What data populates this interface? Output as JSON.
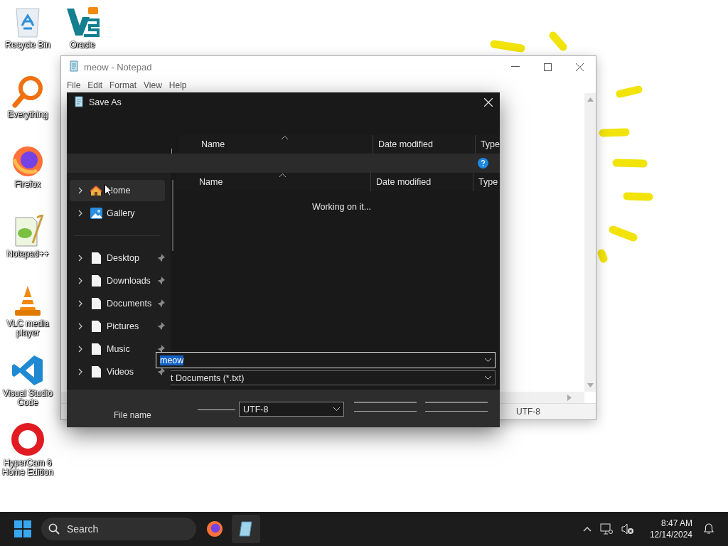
{
  "desktop_icons": [
    {
      "label": "Recycle Bin",
      "kind": "recycle"
    },
    {
      "label": "Oracle",
      "kind": "oracle"
    },
    {
      "label": "Everything",
      "kind": "everything"
    },
    {
      "label": "Firefox",
      "kind": "firefox"
    },
    {
      "label": "Notepad++",
      "kind": "notepadpp"
    },
    {
      "label": "VLC media player",
      "kind": "vlc"
    },
    {
      "label": "Visual Studio Code",
      "kind": "vscode"
    },
    {
      "label": "HyperCam 6 Home Edition",
      "kind": "hypercam"
    }
  ],
  "notepad": {
    "title": "meow - Notepad",
    "menu": [
      "File",
      "Edit",
      "Format",
      "View",
      "Help"
    ],
    "status_encoding": "UTF-8"
  },
  "save_dialog": {
    "title": "Save As",
    "columns": [
      "Name",
      "Date modified",
      "Type"
    ],
    "columns_lower": [
      "Name",
      "Date modified",
      "Type"
    ],
    "message": "Working on it...",
    "nav_top": [
      {
        "label": "Home",
        "kind": "home",
        "selected": true
      },
      {
        "label": "Gallery",
        "kind": "gallery",
        "selected": false
      }
    ],
    "nav_pinned": [
      {
        "label": "Desktop",
        "selected": false
      },
      {
        "label": "Downloads",
        "selected": false
      },
      {
        "label": "Documents",
        "selected": false
      },
      {
        "label": "Pictures",
        "selected": false
      },
      {
        "label": "Music",
        "selected": false
      },
      {
        "label": "Videos",
        "selected": false
      }
    ],
    "file_name_label": "File name",
    "file_name": "meow",
    "file_type": "t Documents (*.txt)",
    "encoding": "UTF-8"
  },
  "taskbar": {
    "search_placeholder": "Search",
    "apps": [
      {
        "kind": "firefox",
        "selected": false
      },
      {
        "kind": "notepad",
        "selected": true
      }
    ],
    "time": "8:47 AM",
    "date": "12/14/2024"
  }
}
